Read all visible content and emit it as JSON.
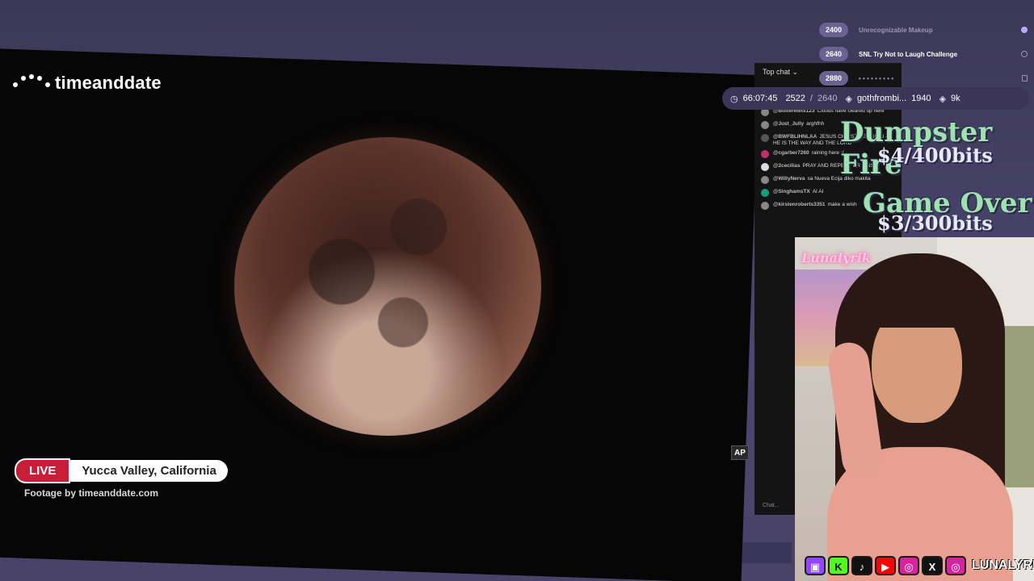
{
  "video": {
    "brand": "timeanddate",
    "live_label": "LIVE",
    "location": "Yucca Valley, California",
    "footage": "Footage by timeanddate.com",
    "corner_logo": "AP"
  },
  "chat": {
    "header": "Top chat",
    "input_placeholder": "Chat...",
    "messages": [
      {
        "user": "@Butteredits123",
        "text": "Clouds have cleared up here",
        "color": "#888888"
      },
      {
        "user": "@Just_Jully",
        "text": "arghfhh",
        "color": "#888888"
      },
      {
        "user": "@BWFBLIHNLAA",
        "text": "JESUS CHRIST RELIGION - HE IS THE WAY AND THE LORD",
        "color": "#555555"
      },
      {
        "user": "@cgarber7260",
        "text": "raining here :(",
        "color": "#c0306a"
      },
      {
        "user": "@2cecilias",
        "text": "PRAY AND REPENT UR SINS",
        "color": "#dddddd"
      },
      {
        "user": "@WillyNerva",
        "text": "sa Nueva Ecija diko makita",
        "color": "#888888"
      },
      {
        "user": "@SinghamsTX",
        "text": "AI AI",
        "color": "#1a9e7a"
      },
      {
        "user": "@kirstenroberts3351",
        "text": "make a wish",
        "color": "#888888"
      }
    ]
  },
  "goals": [
    {
      "amount": "2400",
      "label": "Unrecognizable Makeup",
      "state": "done"
    },
    {
      "amount": "2640",
      "label": "SNL Try Not to Laugh Challenge",
      "state": "current"
    },
    {
      "amount": "2880",
      "label": "",
      "state": "locked"
    }
  ],
  "stats": {
    "timer": "66:07:45",
    "progress_current": "2522",
    "progress_sep": "/",
    "progress_goal": "2640",
    "top_user": "gothfrombi...",
    "top_user_amount": "1940",
    "total": "9k"
  },
  "overlay": {
    "title1": "Dumpster Fire",
    "sub1": "$4/400bits",
    "title2": "Game Over",
    "sub2": "$3/300bits"
  },
  "cam": {
    "neon_sign": "Lunalyrik"
  },
  "social": {
    "icons": [
      "twitch-icon",
      "kick-icon",
      "tiktok-icon",
      "youtube-icon",
      "instagram-icon",
      "x-icon",
      "instagram-icon"
    ],
    "handle": "LUNALYRIK"
  },
  "colors": {
    "accent": "#6a6391",
    "live_red": "#c81e3a",
    "title_green": "#9de3b0",
    "background": "#4a4569"
  }
}
